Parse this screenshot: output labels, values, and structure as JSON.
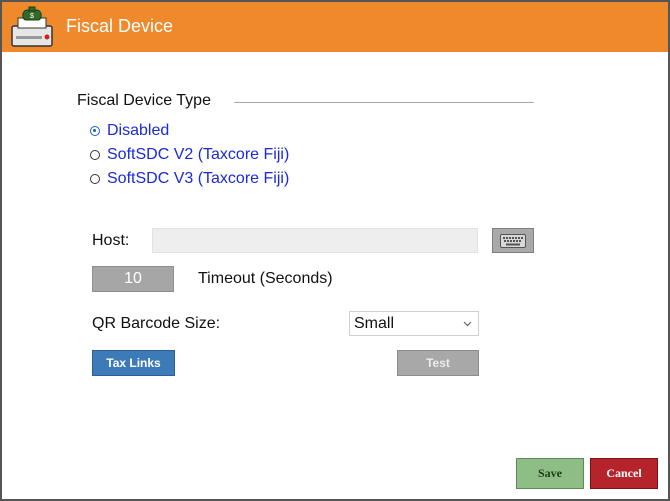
{
  "window": {
    "title": "Fiscal Device",
    "icon": "fiscal-printer-icon",
    "accent_color": "#ef8a2c"
  },
  "fiscal_device_type": {
    "legend": "Fiscal Device Type",
    "options": [
      {
        "label": "Disabled",
        "checked": true
      },
      {
        "label": "SoftSDC V2 (Taxcore Fiji)",
        "checked": false
      },
      {
        "label": "SoftSDC V3 (Taxcore Fiji)",
        "checked": false
      }
    ]
  },
  "host": {
    "label": "Host:",
    "value": "",
    "keyboard_icon": "keyboard-icon"
  },
  "timeout": {
    "value": "10",
    "label": "Timeout (Seconds)"
  },
  "qr_barcode": {
    "label": "QR Barcode Size:",
    "selected": "Small",
    "icon": "chevron-down-icon"
  },
  "buttons": {
    "tax_links": "Tax Links",
    "test": "Test",
    "save": "Save",
    "cancel": "Cancel"
  },
  "colors": {
    "tax_links": "#3d7ab8",
    "save": "#8fbd86",
    "cancel": "#b5242a",
    "radio_label": "#1a2ad6"
  }
}
